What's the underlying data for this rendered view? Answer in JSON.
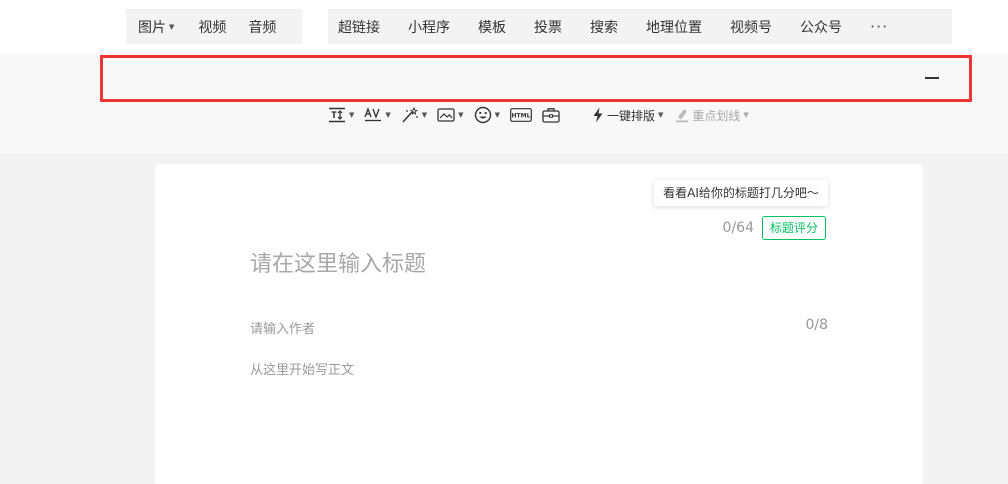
{
  "toolbar": {
    "media": [
      {
        "label": "图片",
        "has_caret": true
      },
      {
        "label": "视频",
        "has_caret": false
      },
      {
        "label": "音频",
        "has_caret": false
      }
    ],
    "insert": [
      "超链接",
      "小程序",
      "模板",
      "投票",
      "搜索",
      "地理位置",
      "视频号",
      "公众号"
    ],
    "more_label": "···"
  },
  "format_toolbar": {
    "icons": [
      "line-height-icon",
      "letter-spacing-icon",
      "magic-wand-icon",
      "image-style-icon",
      "emoji-icon",
      "html-icon",
      "toolbox-icon"
    ],
    "one_click_layout": "一键排版",
    "key_underline": "重点划线"
  },
  "editor": {
    "tooltip": "看看AI给你的标题打几分吧～",
    "title_count": "0/64",
    "score_button": "标题评分",
    "title_placeholder": "请在这里输入标题",
    "author_placeholder": "请输入作者",
    "author_count": "0/8",
    "body_placeholder": "从这里开始写正文"
  },
  "colors": {
    "accent": "#07c160",
    "highlight_border": "#ee3535"
  }
}
